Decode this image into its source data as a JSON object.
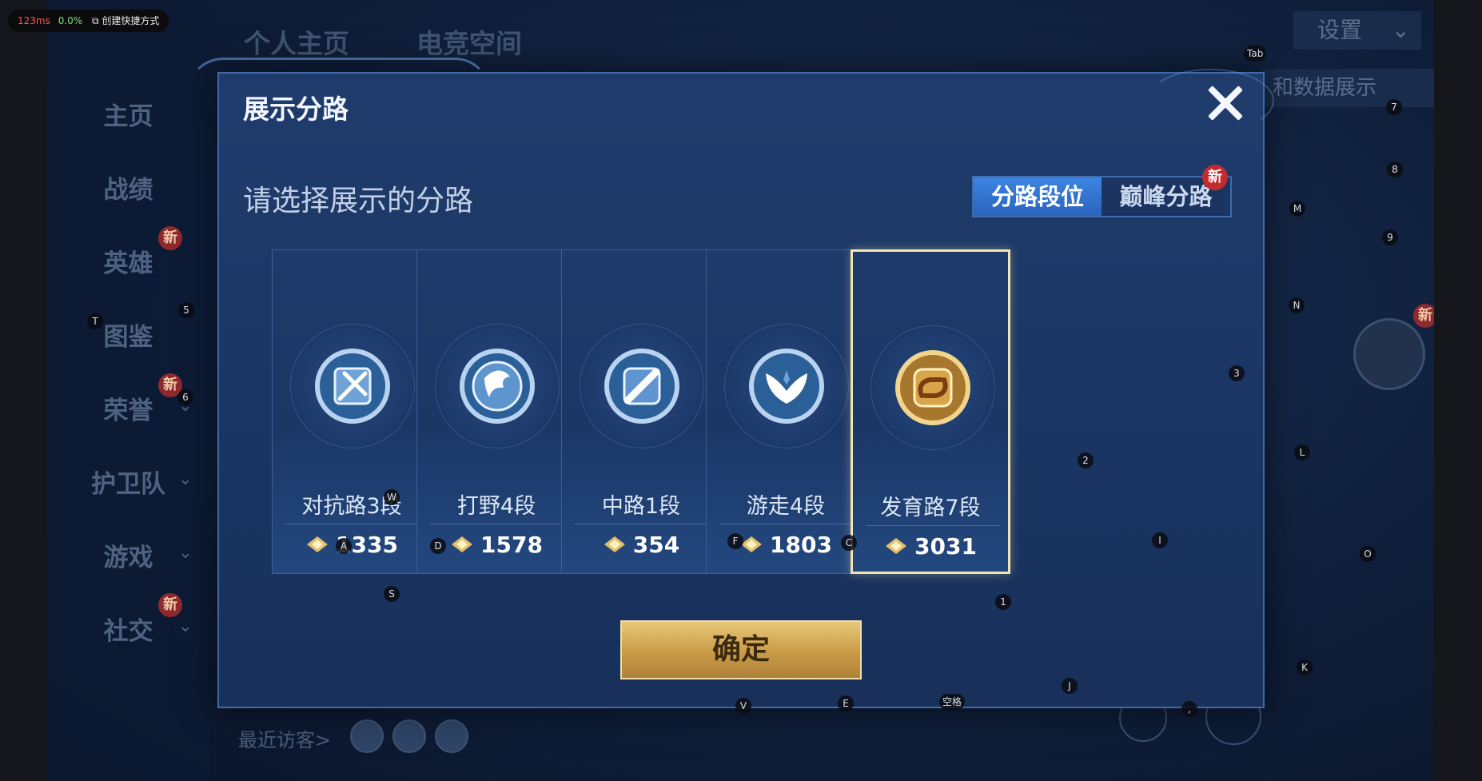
{
  "perf": {
    "latency": "123ms",
    "load": "0.0%",
    "shortcut": "创建快捷方式"
  },
  "background": {
    "top_tabs": [
      "个人主页",
      "电竞空间"
    ],
    "settings_label": "设置",
    "data_panel_label": "和数据展示",
    "nav": [
      {
        "label": "主页"
      },
      {
        "label": "战绩"
      },
      {
        "label": "英雄",
        "badge": "新"
      },
      {
        "label": "图鉴"
      },
      {
        "label": "荣誉",
        "badge": "新"
      },
      {
        "label": "护卫队"
      },
      {
        "label": "游戏"
      },
      {
        "label": "社交",
        "badge": "新"
      }
    ],
    "visitors_label": "最近访客>",
    "avatar_badge": "新"
  },
  "dialog": {
    "title": "展示分路",
    "prompt": "请选择展示的分路",
    "segment": {
      "active": "分路段位",
      "inactive": "巅峰分路",
      "new_badge": "新"
    },
    "lanes": [
      {
        "name": "对抗路3段",
        "points": "1335",
        "emblem": "sword-shield-emblem-icon",
        "color": "#9cc3e8"
      },
      {
        "name": "打野4段",
        "points": "1578",
        "emblem": "dragon-emblem-icon",
        "color": "#9cc3e8"
      },
      {
        "name": "中路1段",
        "points": "354",
        "emblem": "staff-emblem-icon",
        "color": "#9cc3e8"
      },
      {
        "name": "游走4段",
        "points": "1803",
        "emblem": "wings-emblem-icon",
        "color": "#9cc3e8"
      },
      {
        "name": "发育路7段",
        "points": "3031",
        "emblem": "gold-arrow-emblem-icon",
        "color": "#e1b45c",
        "selected": true
      }
    ],
    "confirm": "确定"
  },
  "key_hints": [
    "Tab",
    "7",
    "8",
    "M",
    "9",
    "N",
    "3",
    "L",
    "O",
    "K",
    "T",
    "5",
    "6",
    "W",
    "D",
    "A",
    "F",
    "C",
    "2",
    "I",
    "S",
    "1",
    "V",
    "E",
    "空格",
    "J",
    ","
  ]
}
